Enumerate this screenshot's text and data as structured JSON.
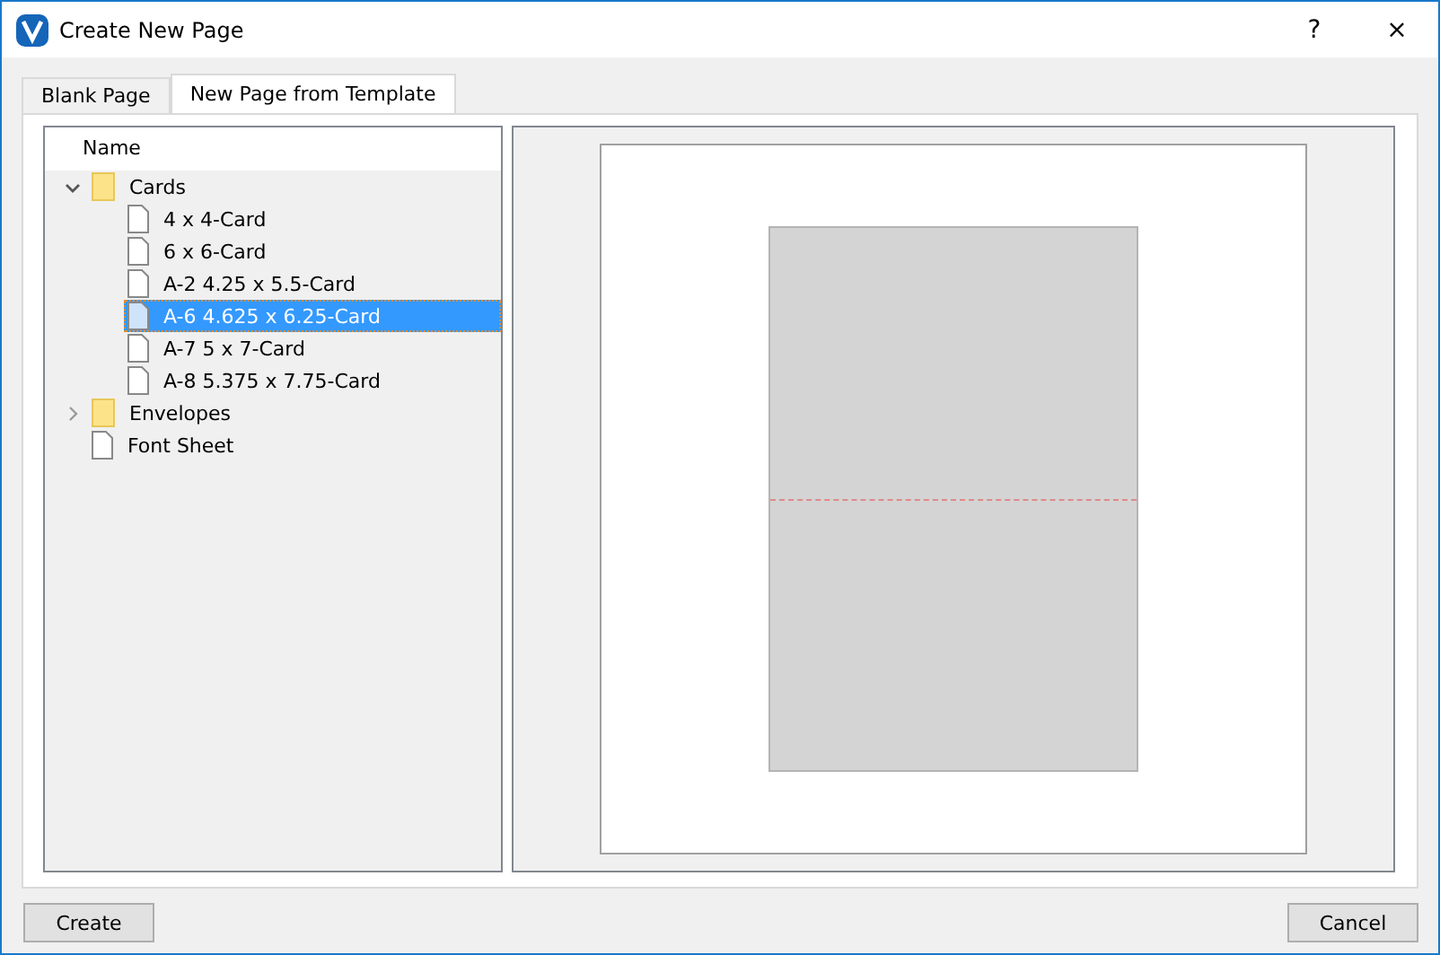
{
  "window": {
    "title": "Create New Page",
    "help": "?",
    "close": "×"
  },
  "tabs": [
    {
      "label": "Blank Page",
      "selected": false
    },
    {
      "label": "New Page from Template",
      "selected": true
    }
  ],
  "tree": {
    "column": "Name",
    "items": [
      {
        "label": "Cards",
        "kind": "folder",
        "expanded": true,
        "selected": false,
        "children": [
          {
            "label": "4 x 4-Card",
            "kind": "file",
            "selected": false
          },
          {
            "label": "6 x 6-Card",
            "kind": "file",
            "selected": false
          },
          {
            "label": "A-2 4.25 x 5.5-Card",
            "kind": "file",
            "selected": false
          },
          {
            "label": "A-6 4.625 x 6.25-Card",
            "kind": "file",
            "selected": true
          },
          {
            "label": "A-7 5 x 7-Card",
            "kind": "file",
            "selected": false
          },
          {
            "label": "A-8 5.375 x 7.75-Card",
            "kind": "file",
            "selected": false
          }
        ]
      },
      {
        "label": "Envelopes",
        "kind": "folder",
        "expanded": false,
        "selected": false
      },
      {
        "label": "Font Sheet",
        "kind": "file",
        "selected": false
      }
    ]
  },
  "buttons": [
    "Create",
    "Cancel"
  ]
}
